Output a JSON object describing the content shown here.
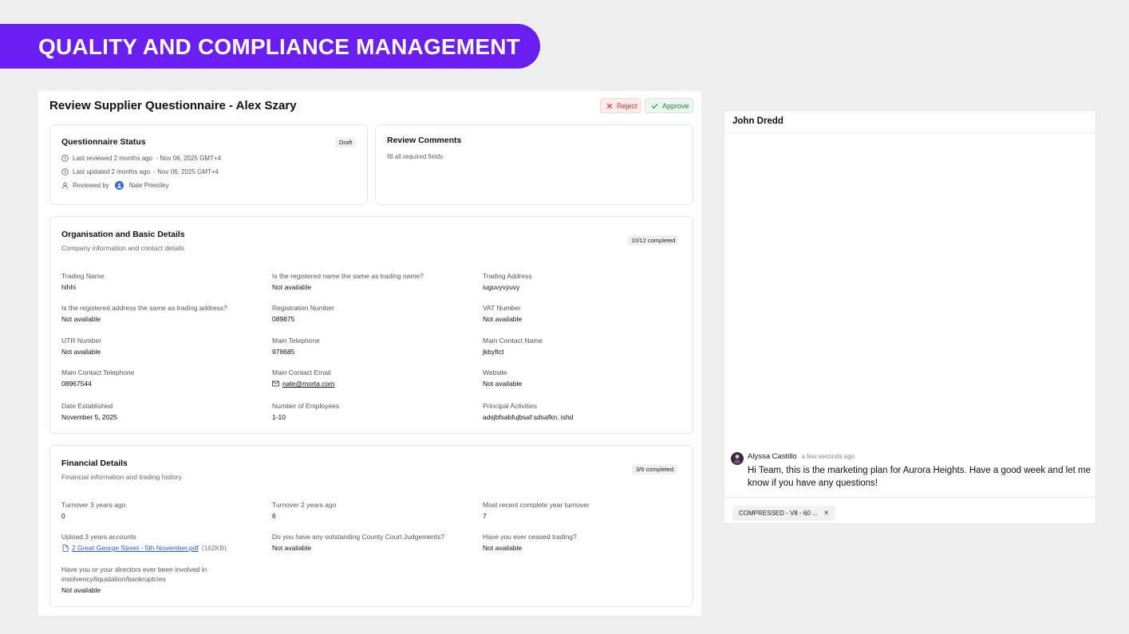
{
  "banner": {
    "title": "QUALITY AND COMPLIANCE MANAGEMENT"
  },
  "header": {
    "title": "Review Supplier Questionnaire - Alex Szary",
    "reject_label": "Reject",
    "approve_label": "Approve"
  },
  "status_card": {
    "title": "Questionnaire Status",
    "badge": "Draft",
    "last_reviewed": "Last reviewed 2 months ago  - Nov 06, 2025 GMT+4",
    "last_updated": "Last updated 2 months ago  - Nov 06, 2025 GMT+4",
    "reviewed_by_label": "Reviewed by",
    "reviewer": "Nate Priestley"
  },
  "comments_card": {
    "title": "Review Comments",
    "text": "fill all required fields"
  },
  "org_section": {
    "title": "Organisation and Basic Details",
    "subtitle": "Company information and contact details",
    "badge": "10/12 completed",
    "fields": [
      {
        "label": "Trading Name",
        "value": "hihhi"
      },
      {
        "label": "Is the registered name the same as trading name?",
        "value": "Not available"
      },
      {
        "label": "Trading Address",
        "value": "iuguvyvyuvy"
      },
      {
        "label": "Is the registered address the same as trading address?",
        "value": "Not available"
      },
      {
        "label": "Registration Number",
        "value": "089875"
      },
      {
        "label": "VAT Number",
        "value": "Not available"
      },
      {
        "label": "UTR Number",
        "value": "Not available"
      },
      {
        "label": "Main Telephone",
        "value": "978685"
      },
      {
        "label": "Main Contact Name",
        "value": "jkbyftct"
      },
      {
        "label": "Main Contact Telephone",
        "value": "08967544"
      },
      {
        "label": "Main Contact Email",
        "value": "nate@morta.com"
      },
      {
        "label": "Website",
        "value": "Not available"
      },
      {
        "label": "Date Established",
        "value": "November 5, 2025"
      },
      {
        "label": "Number of Employees",
        "value": "1-10"
      },
      {
        "label": "Principal Activities",
        "value": "adsjbfsabfujbsaf sdsafkn. ishd"
      }
    ]
  },
  "fin_section": {
    "title": "Financial Details",
    "subtitle": "Financial information and trading history",
    "badge": "3/6 completed",
    "fields": [
      {
        "label": "Turnover 3 years ago",
        "value": "0"
      },
      {
        "label": "Turnover 2 years ago",
        "value": "6"
      },
      {
        "label": "Most recent complete year turnover",
        "value": "7"
      },
      {
        "label": "Upload 3 years accounts",
        "value": "2 Great George Street - 5th November.pdf",
        "extra": "(162KB)"
      },
      {
        "label": "Do you have any outstanding County Court Judgements?",
        "value": "Not available"
      },
      {
        "label": "Have you ever ceased trading?",
        "value": "Not available"
      },
      {
        "label": "Have you or your directors ever been involved in insolvency/liquidation/bankruptcies",
        "value": "Not available"
      }
    ]
  },
  "chat": {
    "recipient": "John Dredd",
    "message": {
      "author": "Alyssa Castillo",
      "time": "a few seconds ago",
      "text": "Hi Team, this is the marketing plan for Aurora Heights. Have a good week and let me know if you have any questions!"
    },
    "attachment": "COMPRESSED - V8 - 60 ...",
    "attachment_close": "×"
  },
  "colors": {
    "brand": "#6a1ef2",
    "reject": "#d93434",
    "approve": "#1e8a47",
    "link": "#2d5bd7"
  }
}
